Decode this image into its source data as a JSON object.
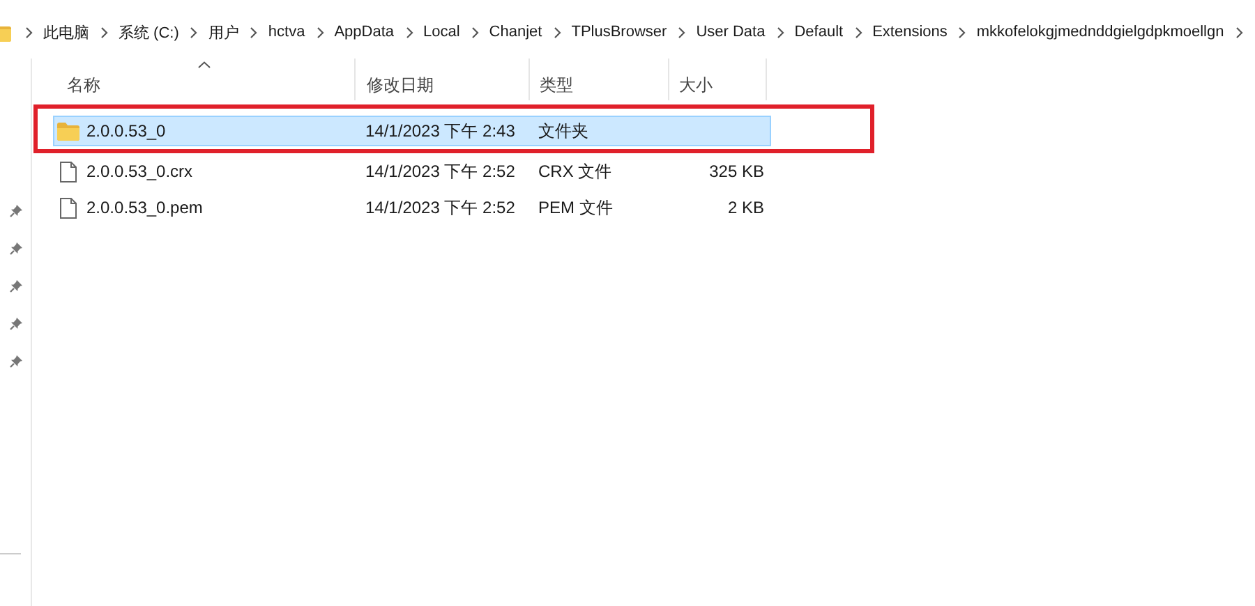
{
  "breadcrumb": [
    "此电脑",
    "系统 (C:)",
    "用户",
    "hctva",
    "AppData",
    "Local",
    "Chanjet",
    "TPlusBrowser",
    "User Data",
    "Default",
    "Extensions",
    "mkkofelokgjmednddgielgdpkmoellgn"
  ],
  "columns": [
    {
      "label": "名称",
      "sorted": true
    },
    {
      "label": "修改日期",
      "sorted": false
    },
    {
      "label": "类型",
      "sorted": false
    },
    {
      "label": "大小",
      "sorted": false
    }
  ],
  "rows": [
    {
      "kind": "folder",
      "name": "2.0.0.53_0",
      "date": "14/1/2023 下午 2:43",
      "type": "文件夹",
      "selected": true,
      "highlighted": true
    },
    {
      "kind": "file",
      "name": "2.0.0.53_0.crx",
      "date": "14/1/2023 下午 2:52",
      "type": "CRX 文件",
      "size": "325 KB",
      "selected": false,
      "highlighted": false
    },
    {
      "kind": "file",
      "name": "2.0.0.53_0.pem",
      "date": "14/1/2023 下午 2:52",
      "type": "PEM 文件",
      "size": "2 KB",
      "selected": false,
      "highlighted": false
    }
  ]
}
